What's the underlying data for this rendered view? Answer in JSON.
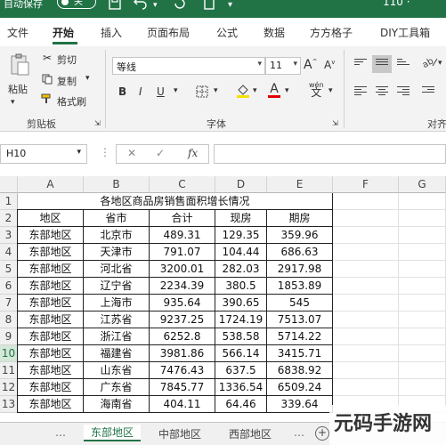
{
  "titlebar": {
    "autosave": "自动保存",
    "toggle": "关",
    "right": "110 ·"
  },
  "tabs": [
    "文件",
    "开始",
    "插入",
    "页面布局",
    "公式",
    "数据",
    "方方格子",
    "DIY工具箱"
  ],
  "ribbon": {
    "paste": "粘贴",
    "cut": "剪切",
    "copy": "复制",
    "format_painter": "格式刷",
    "clipboard": "剪贴板",
    "font_name": "等线",
    "font_size": "11",
    "font_group": "字体",
    "align_group": "对齐",
    "bold": "B",
    "italic": "I",
    "underline": "U",
    "grow": "A",
    "shrink": "A",
    "wen": "wén",
    "wen_char": "文",
    "font_a": "A"
  },
  "formula": {
    "name_box": "H10",
    "fx": "fx",
    "cancel": "✕",
    "confirm": "✓"
  },
  "grid": {
    "columns": [
      "A",
      "B",
      "C",
      "D",
      "E",
      "F",
      "G"
    ],
    "rows": [
      "1",
      "2",
      "3",
      "4",
      "5",
      "6",
      "7",
      "8",
      "9",
      "10",
      "11",
      "12",
      "13"
    ],
    "title": "各地区商品房销售面积增长情况",
    "headers": [
      "地区",
      "省市",
      "合计",
      "现房",
      "期房"
    ],
    "data": [
      [
        "东部地区",
        "北京市",
        "489.31",
        "129.35",
        "359.96"
      ],
      [
        "东部地区",
        "天津市",
        "791.07",
        "104.44",
        "686.63"
      ],
      [
        "东部地区",
        "河北省",
        "3200.01",
        "282.03",
        "2917.98"
      ],
      [
        "东部地区",
        "辽宁省",
        "2234.39",
        "380.5",
        "1853.89"
      ],
      [
        "东部地区",
        "上海市",
        "935.64",
        "390.65",
        "545"
      ],
      [
        "东部地区",
        "江苏省",
        "9237.25",
        "1724.19",
        "7513.07"
      ],
      [
        "东部地区",
        "浙江省",
        "6252.8",
        "538.58",
        "5714.22"
      ],
      [
        "东部地区",
        "福建省",
        "3981.86",
        "566.14",
        "3415.71"
      ],
      [
        "东部地区",
        "山东省",
        "7476.43",
        "637.5",
        "6838.92"
      ],
      [
        "东部地区",
        "广东省",
        "7845.77",
        "1336.54",
        "6509.24"
      ],
      [
        "东部地区",
        "海南省",
        "404.11",
        "64.46",
        "339.64"
      ]
    ]
  },
  "sheets": [
    "东部地区",
    "中部地区",
    "西部地区"
  ],
  "add_sheet": "+",
  "watermark": "元码手游网",
  "colors": {
    "accent": "#217346"
  }
}
